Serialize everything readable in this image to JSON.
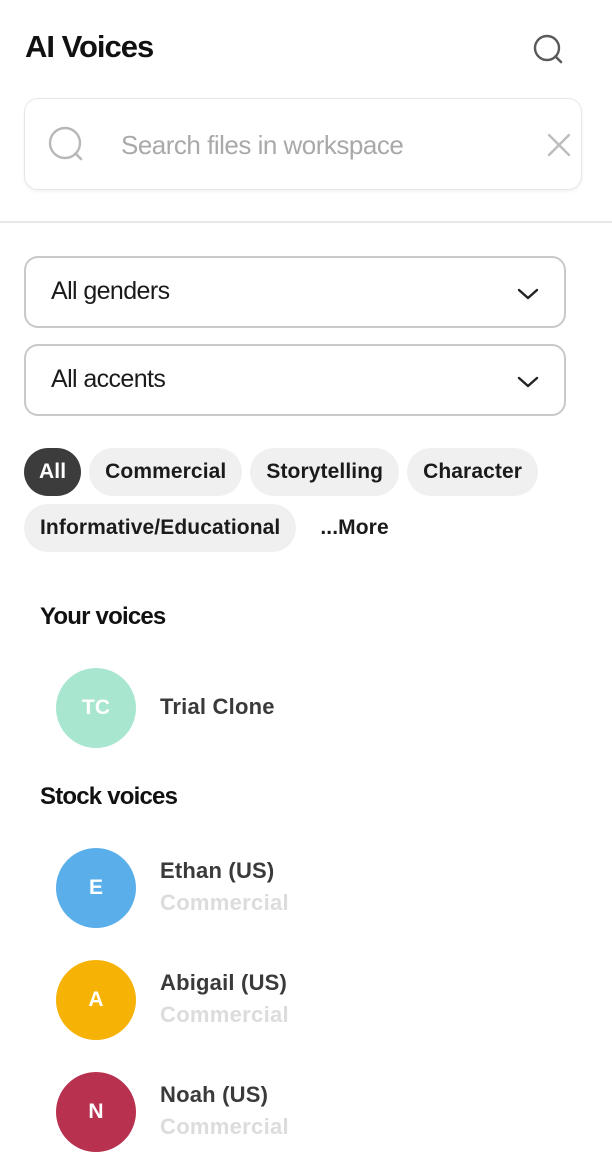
{
  "header": {
    "title": "AI Voices",
    "search_icon": "search-icon"
  },
  "search": {
    "placeholder": "Search files in workspace",
    "value": "",
    "leading_icon": "search-icon",
    "clear_icon": "close-icon"
  },
  "filters": {
    "gender": {
      "selected": "All genders",
      "icon": "chevron-down-icon"
    },
    "accent": {
      "selected": "All accents",
      "icon": "chevron-down-icon"
    }
  },
  "categories": {
    "active": "All",
    "chips": [
      {
        "label": "All",
        "active": true
      },
      {
        "label": "Commercial",
        "active": false
      },
      {
        "label": "Storytelling",
        "active": false
      },
      {
        "label": "Character",
        "active": false
      },
      {
        "label": "Informative/Educational",
        "active": false
      }
    ],
    "more_label": "...More"
  },
  "your_voices": {
    "title": "Your voices",
    "items": [
      {
        "initials": "TC",
        "name": "Trial Clone",
        "color": "#a8e6d0"
      }
    ]
  },
  "stock_voices": {
    "title": "Stock voices",
    "items": [
      {
        "initials": "E",
        "name": "Ethan (US)",
        "category": "Commercial",
        "color": "#5aafea"
      },
      {
        "initials": "A",
        "name": "Abigail (US)",
        "category": "Commercial",
        "color": "#f6b205"
      },
      {
        "initials": "N",
        "name": "Noah (US)",
        "category": "Commercial",
        "color": "#b8324f"
      }
    ]
  },
  "colors": {
    "chip_active_bg": "#3c3c3c",
    "chip_bg": "#f0f0f0",
    "category_text": "#dcdcdc"
  }
}
